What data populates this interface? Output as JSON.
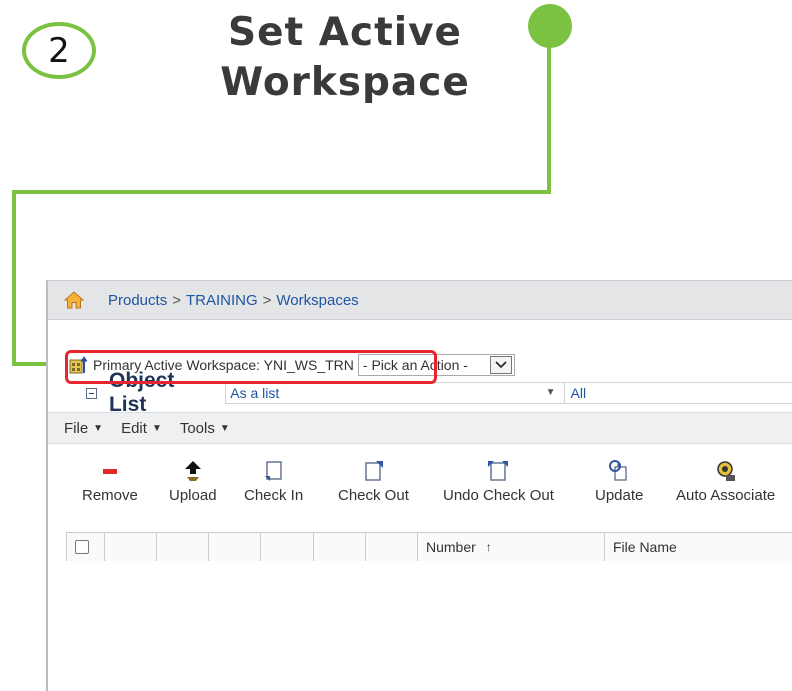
{
  "callout": {
    "step_number": "2",
    "title_line1": "Set Active",
    "title_line2": "Workspace",
    "accent_color": "#7cc242",
    "highlight_color": "#e8252f"
  },
  "breadcrumb": {
    "items": [
      "Products",
      "TRAINING",
      "Workspaces"
    ],
    "separator": ">"
  },
  "workspace": {
    "label": "Primary Active Workspace: YNI_WS_TRN",
    "action_select": "- Pick an Action -"
  },
  "object_list": {
    "title": "Object List",
    "view_value": "As a list",
    "filter_value": "All"
  },
  "menu": {
    "items": [
      "File",
      "Edit",
      "Tools"
    ]
  },
  "toolbar": {
    "buttons": [
      {
        "label": "Remove",
        "icon": "remove-icon"
      },
      {
        "label": "Upload",
        "icon": "upload-icon"
      },
      {
        "label": "Check In",
        "icon": "check-in-icon"
      },
      {
        "label": "Check Out",
        "icon": "check-out-icon"
      },
      {
        "label": "Undo Check Out",
        "icon": "undo-check-out-icon"
      },
      {
        "label": "Update",
        "icon": "update-icon"
      },
      {
        "label": "Auto Associate",
        "icon": "auto-associate-icon"
      }
    ]
  },
  "table": {
    "columns": [
      "Number",
      "File Name"
    ],
    "sort_indicator": "↑",
    "sorted_column": "Number"
  }
}
